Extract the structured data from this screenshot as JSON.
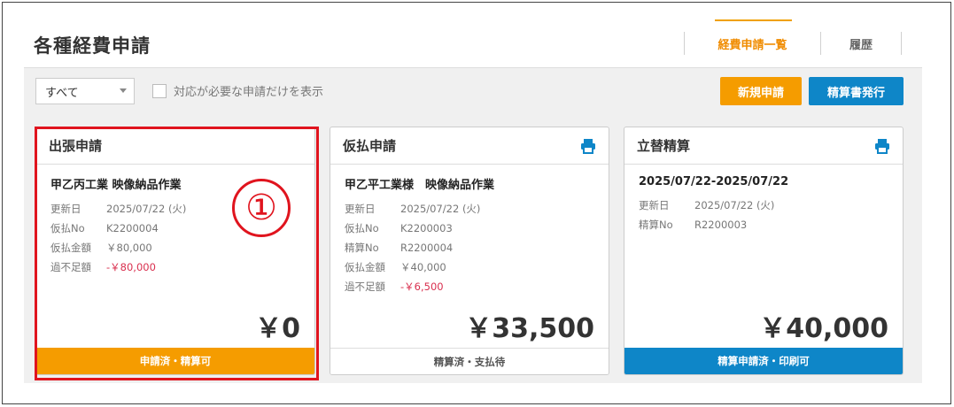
{
  "header": {
    "title": "各種経費申請",
    "tabs": [
      {
        "label": "経費申請一覧",
        "active": true
      },
      {
        "label": "履歴",
        "active": false
      }
    ]
  },
  "filters": {
    "select_value": "すべて",
    "checkbox_label": "対応が必要な申請だけを表示",
    "checkbox_checked": false
  },
  "actions": {
    "new_label": "新規申請",
    "issue_label": "精算書発行"
  },
  "colors": {
    "accent_orange": "#f59c00",
    "accent_blue": "#0e86c8",
    "negative_red": "#d9304f",
    "highlight_red": "#e0141e"
  },
  "cards": [
    {
      "title": "出張申請",
      "has_print_icon": false,
      "subject": "甲乙丙工業 映像納品作業",
      "rows": [
        {
          "key": "更新日",
          "value": "2025/07/22 (火)"
        },
        {
          "key": "仮払No",
          "value": "K2200004"
        },
        {
          "key": "仮払金額",
          "value": "￥80,000"
        },
        {
          "key": "過不足額",
          "value": "-￥80,000"
        }
      ],
      "amount": "￥0",
      "status": "申請済・精算可"
    },
    {
      "title": "仮払申請",
      "has_print_icon": true,
      "subject": "甲乙平工業様　映像納品作業",
      "rows": [
        {
          "key": "更新日",
          "value": "2025/07/22 (火)"
        },
        {
          "key": "仮払No",
          "value": "K2200003"
        },
        {
          "key": "精算No",
          "value": "R2200004"
        },
        {
          "key": "仮払金額",
          "value": "￥40,000"
        },
        {
          "key": "過不足額",
          "value": "-￥6,500"
        }
      ],
      "amount": "￥33,500",
      "status": "精算済・支払待"
    },
    {
      "title": "立替精算",
      "has_print_icon": true,
      "subject": "2025/07/22-2025/07/22",
      "rows": [
        {
          "key": "更新日",
          "value": "2025/07/22 (火)"
        },
        {
          "key": "精算No",
          "value": "R2200003"
        }
      ],
      "amount": "￥40,000",
      "status": "精算申請済・印刷可"
    }
  ],
  "annotation": {
    "marker": "①"
  }
}
